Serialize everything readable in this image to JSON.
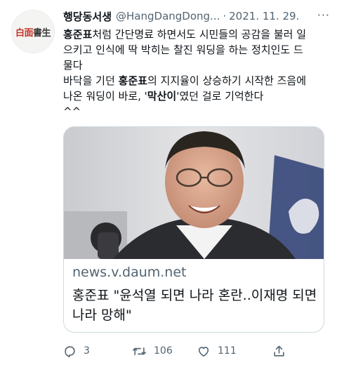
{
  "tweet": {
    "avatar": {
      "text_a": "白面",
      "text_b": "書生"
    },
    "display_name": "행당동서생",
    "handle": "@HangDangDong...",
    "separator": "·",
    "date": "2021. 11. 29.",
    "more": "···",
    "lines": [
      [
        {
          "t": "홍준표",
          "b": true
        },
        {
          "t": "처럼 간단명료 하면서도 시민들의 공감을 불러 일",
          "b": false
        }
      ],
      [
        {
          "t": "으키고 인식에 딱 박히는 찰진 워딩을 하는 정치인도 드",
          "b": false
        }
      ],
      [
        {
          "t": "물다",
          "b": false
        }
      ],
      [
        {
          "t": "바닥을 기던 ",
          "b": false
        },
        {
          "t": "홍준표",
          "b": true
        },
        {
          "t": "의 지지율이 상승하기 시작한 즈음에",
          "b": false
        }
      ],
      [
        {
          "t": "나온 워딩이 바로, '",
          "b": false
        },
        {
          "t": "막산이",
          "b": true
        },
        {
          "t": "'였던 걸로 기억한다",
          "b": false
        }
      ],
      [
        {
          "t": "^^",
          "b": false
        }
      ]
    ],
    "card": {
      "domain": "news.v.daum.net",
      "title": "홍준표 \"윤석열 되면 나라 혼란..이재명 되면 나라 망해\""
    },
    "actions": {
      "replies": "3",
      "retweets": "106",
      "likes": "111"
    }
  },
  "colors": {
    "text": "#0f1419",
    "secondary": "#536471",
    "border": "#cfd9de",
    "avatar_accent": "#c8332a"
  },
  "icons": [
    "reply-icon",
    "retweet-icon",
    "like-icon",
    "share-icon",
    "more-icon"
  ]
}
